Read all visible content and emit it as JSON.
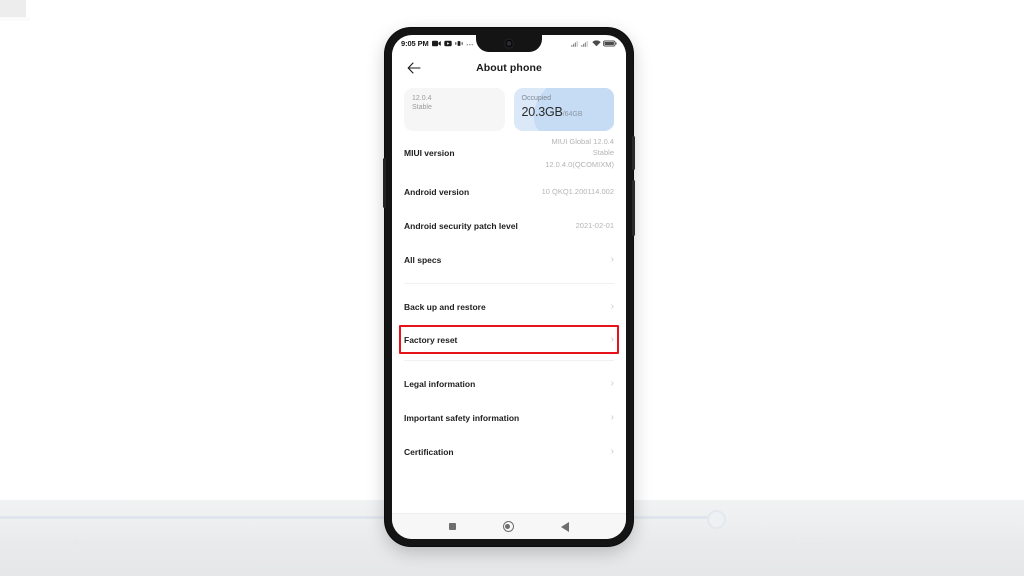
{
  "device": {
    "status_bar": {
      "time": "9:05 PM",
      "left_icons": [
        "video-camera-icon",
        "screen-record-icon",
        "vibrate-icon",
        "more-icon"
      ],
      "right_icons": [
        "signal-bars-icon",
        "signal-bars-2-icon",
        "wifi-icon",
        "battery-icon"
      ]
    },
    "nav_bar": {
      "recents_label": "recents-square",
      "home_label": "home-circle",
      "back_label": "back-triangle"
    }
  },
  "app_bar": {
    "back_icon": "arrow-left-icon",
    "title": "About phone"
  },
  "cards": [
    {
      "id": "version",
      "line1": "12.0.4",
      "line2": "Stable"
    },
    {
      "id": "storage",
      "caption": "Occupied",
      "value": "20.3GB",
      "total": "/64GB"
    }
  ],
  "list": {
    "groups": [
      {
        "rows": [
          {
            "label": "MIUI version",
            "value": "MIUI Global 12.0.4\nStable\n12.0.4.0(QCOMIXM)",
            "value_lines": [
              "MIUI Global 12.0.4",
              "Stable",
              "12.0.4.0(QCOMIXM)"
            ],
            "chevron": false
          },
          {
            "label": "Android version",
            "value": "10 QKQ1.200114.002",
            "chevron": false
          },
          {
            "label": "Android security patch level",
            "value": "2021-02-01",
            "chevron": false
          },
          {
            "label": "All specs",
            "value": "",
            "chevron": true
          }
        ]
      },
      {
        "rows": [
          {
            "label": "Back up and restore",
            "value": "",
            "chevron": true
          },
          {
            "label": "Factory reset",
            "value": "",
            "chevron": true,
            "highlighted": true
          }
        ]
      },
      {
        "rows": [
          {
            "label": "Legal information",
            "value": "",
            "chevron": true
          },
          {
            "label": "Important safety information",
            "value": "",
            "chevron": true
          },
          {
            "label": "Certification",
            "value": "",
            "chevron": true
          }
        ]
      }
    ]
  },
  "annotation": {
    "highlight_color": "#e8131a",
    "highlight_target": "Factory reset"
  },
  "colors": {
    "accent_blue": "#dbe8f8",
    "wave_blue": "#c6dcf4",
    "highlight_red": "#e8131a",
    "text_primary": "#1e1e1e",
    "text_secondary": "#b4b4b4"
  },
  "chevron_glyph": "›"
}
